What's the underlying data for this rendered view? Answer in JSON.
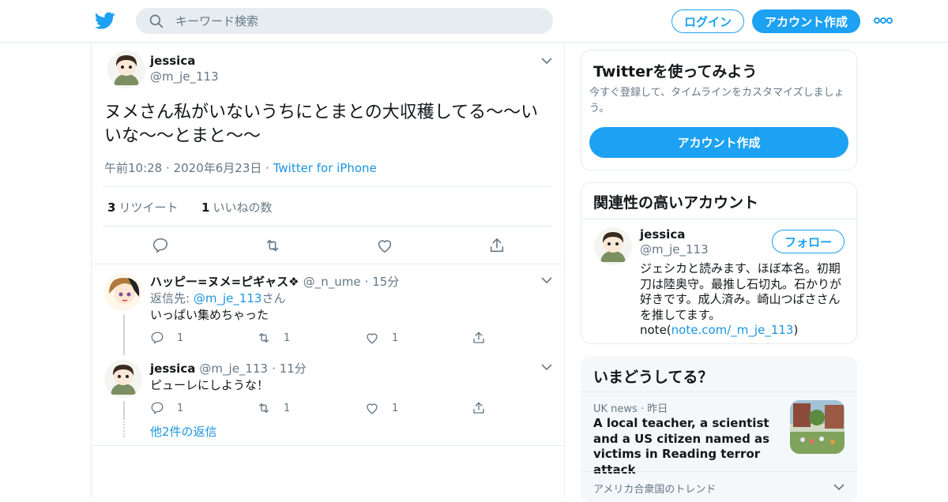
{
  "header": {
    "search_placeholder": "キーワード検索",
    "login_label": "ログイン",
    "signup_label": "アカウント作成"
  },
  "tweet": {
    "name": "jessica",
    "handle": "@m_je_113",
    "text": "ヌメさん私がいないうちにとまとの大収穫してる〜〜いいな〜〜とまと〜〜",
    "time": "午前10:28",
    "date": "2020年6月23日",
    "source": "Twitter for iPhone",
    "retweet_count": "3",
    "retweet_label": "リツイート",
    "like_count": "1",
    "like_label": "いいねの数"
  },
  "replies": [
    {
      "name": "ハッピー=ヌメ=ピギャス❖",
      "handle": "@_n_ume",
      "age": "15分",
      "reply_to_prefix": "返信先: ",
      "reply_to_handle": "@m_je_113",
      "reply_to_suffix": "さん",
      "text": "いっぱい集めちゃった",
      "reply_count": "1",
      "retweet_count": "1",
      "like_count": "1"
    },
    {
      "name": "jessica",
      "handle": "@m_je_113",
      "age": "11分",
      "text": "ピューレにしような！",
      "reply_count": "1",
      "retweet_count": "1",
      "like_count": "1"
    }
  ],
  "more_replies_label": "他2件の返信",
  "sidebar": {
    "signup_card": {
      "title": "Twitterを使ってみよう",
      "desc": "今すぐ登録して、タイムラインをカスタマイズしましょう。",
      "button": "アカウント作成"
    },
    "related": {
      "title": "関連性の高いアカウント",
      "name": "jessica",
      "handle": "@m_je_113",
      "follow_label": "フォロー",
      "bio": "ジェシカと読みます、ほぼ本名。初期刀は陸奥守。最推し石切丸。石かりが好きです。成人済み。崎山つばささんを推してます。",
      "bio_note_prefix": "note(",
      "bio_note_link": "note.com/_m_je_113",
      "bio_note_suffix": ")"
    },
    "trends": {
      "title": "いまどうしてる？",
      "news_source": "UK news",
      "news_time": "昨日",
      "news_headline": "A local teacher, a scientist and a US citizen named as victims in Reading terror attack",
      "trend_region": "アメリカ合衆国のトレンド"
    }
  },
  "colors": {
    "accent": "#1da1f2",
    "link": "#1b95e0",
    "muted": "#657786",
    "border": "#e6ecf0"
  }
}
